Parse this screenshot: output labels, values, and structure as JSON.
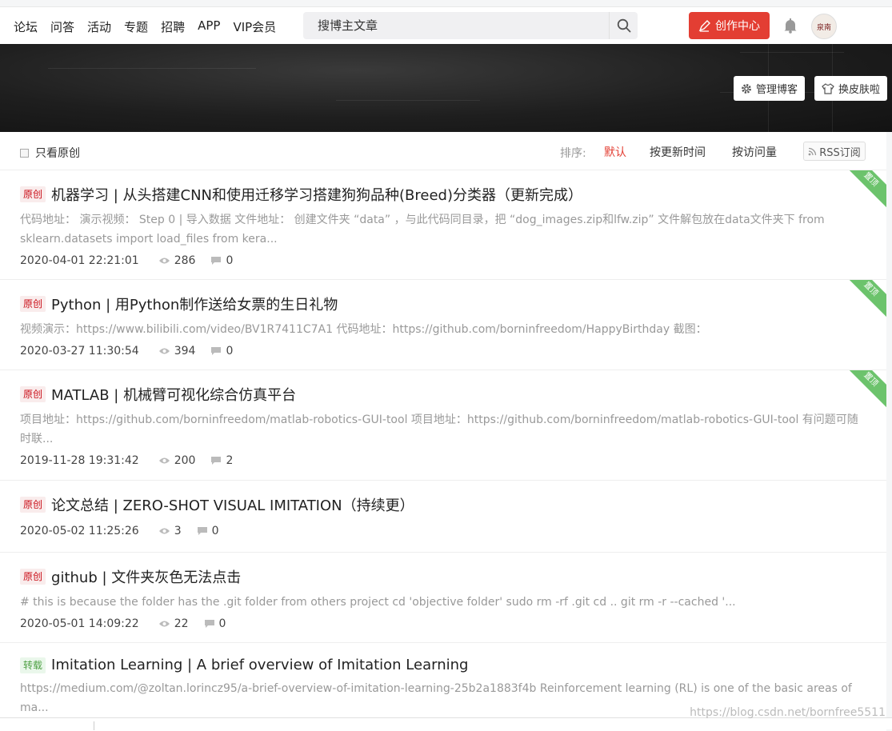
{
  "nav": {
    "items": [
      "论坛",
      "问答",
      "活动",
      "专题",
      "招聘",
      "APP",
      "VIP会员"
    ],
    "search_placeholder": "搜博主文章",
    "create_label": "创作中心",
    "avatar_text": "泉南"
  },
  "banner": {
    "manage_label": "管理博客",
    "skin_label": "换皮肤啦"
  },
  "filter": {
    "original_only": "只看原创",
    "sort_label": "排序:",
    "sort_options": [
      "默认",
      "按更新时间",
      "按访问量"
    ],
    "rss_label": "RSS订阅"
  },
  "articles": [
    {
      "tag": "原创",
      "title": "机器学习 | 从头搭建CNN和使用迁移学习搭建狗狗品种(Breed)分类器（更新完成）",
      "abstract": "代码地址： 演示视频： Step 0 | 导入数据 文件地址： 创建文件夹 “data” ，与此代码同目录，把 “dog_images.zip和lfw.zip” 文件解包放在data文件夹下 from sklearn.datasets import load_files from kera...",
      "date": "2020-04-01 22:21:01",
      "views": "286",
      "comments": "0",
      "pinned": "置顶"
    },
    {
      "tag": "原创",
      "title": "Python | 用Python制作送给女票的生日礼物",
      "abstract": "视频演示：https://www.bilibili.com/video/BV1R7411C7A1 代码地址：https://github.com/borninfreedom/HappyBirthday 截图：",
      "date": "2020-03-27 11:30:54",
      "views": "394",
      "comments": "0",
      "pinned": "置顶"
    },
    {
      "tag": "原创",
      "title": "MATLAB | 机械臂可视化综合仿真平台",
      "abstract": "项目地址：https://github.com/borninfreedom/matlab-robotics-GUI-tool 项目地址：https://github.com/borninfreedom/matlab-robotics-GUI-tool 有问题可随时联...",
      "date": "2019-11-28 19:31:42",
      "views": "200",
      "comments": "2",
      "pinned": "置顶"
    },
    {
      "tag": "原创",
      "title": "论文总结 | ZERO-SHOT VISUAL IMITATION（持续更）",
      "abstract": "",
      "date": "2020-05-02 11:25:26",
      "views": "3",
      "comments": "0",
      "pinned": ""
    },
    {
      "tag": "原创",
      "title": "github | 文件夹灰色无法点击",
      "abstract": "# this is because the folder has the .git folder from others project cd 'objective folder' sudo rm -rf .git cd .. git rm -r --cached '...",
      "date": "2020-05-01 14:09:22",
      "views": "22",
      "comments": "0",
      "pinned": ""
    },
    {
      "tag": "转载",
      "title": "Imitation Learning | A brief overview of Imitation Learning",
      "abstract": "https://medium.com/@zoltan.lorincz95/a-brief-overview-of-imitation-learning-25b2a1883f4b Reinforcement learning (RL) is one of the basic areas of ma...",
      "date": "",
      "views": "",
      "comments": "",
      "pinned": ""
    }
  ],
  "watermark": "https://blog.csdn.net/bornfree5511",
  "colors": {
    "accent": "#e33e33",
    "pin": "#6cc36c"
  }
}
